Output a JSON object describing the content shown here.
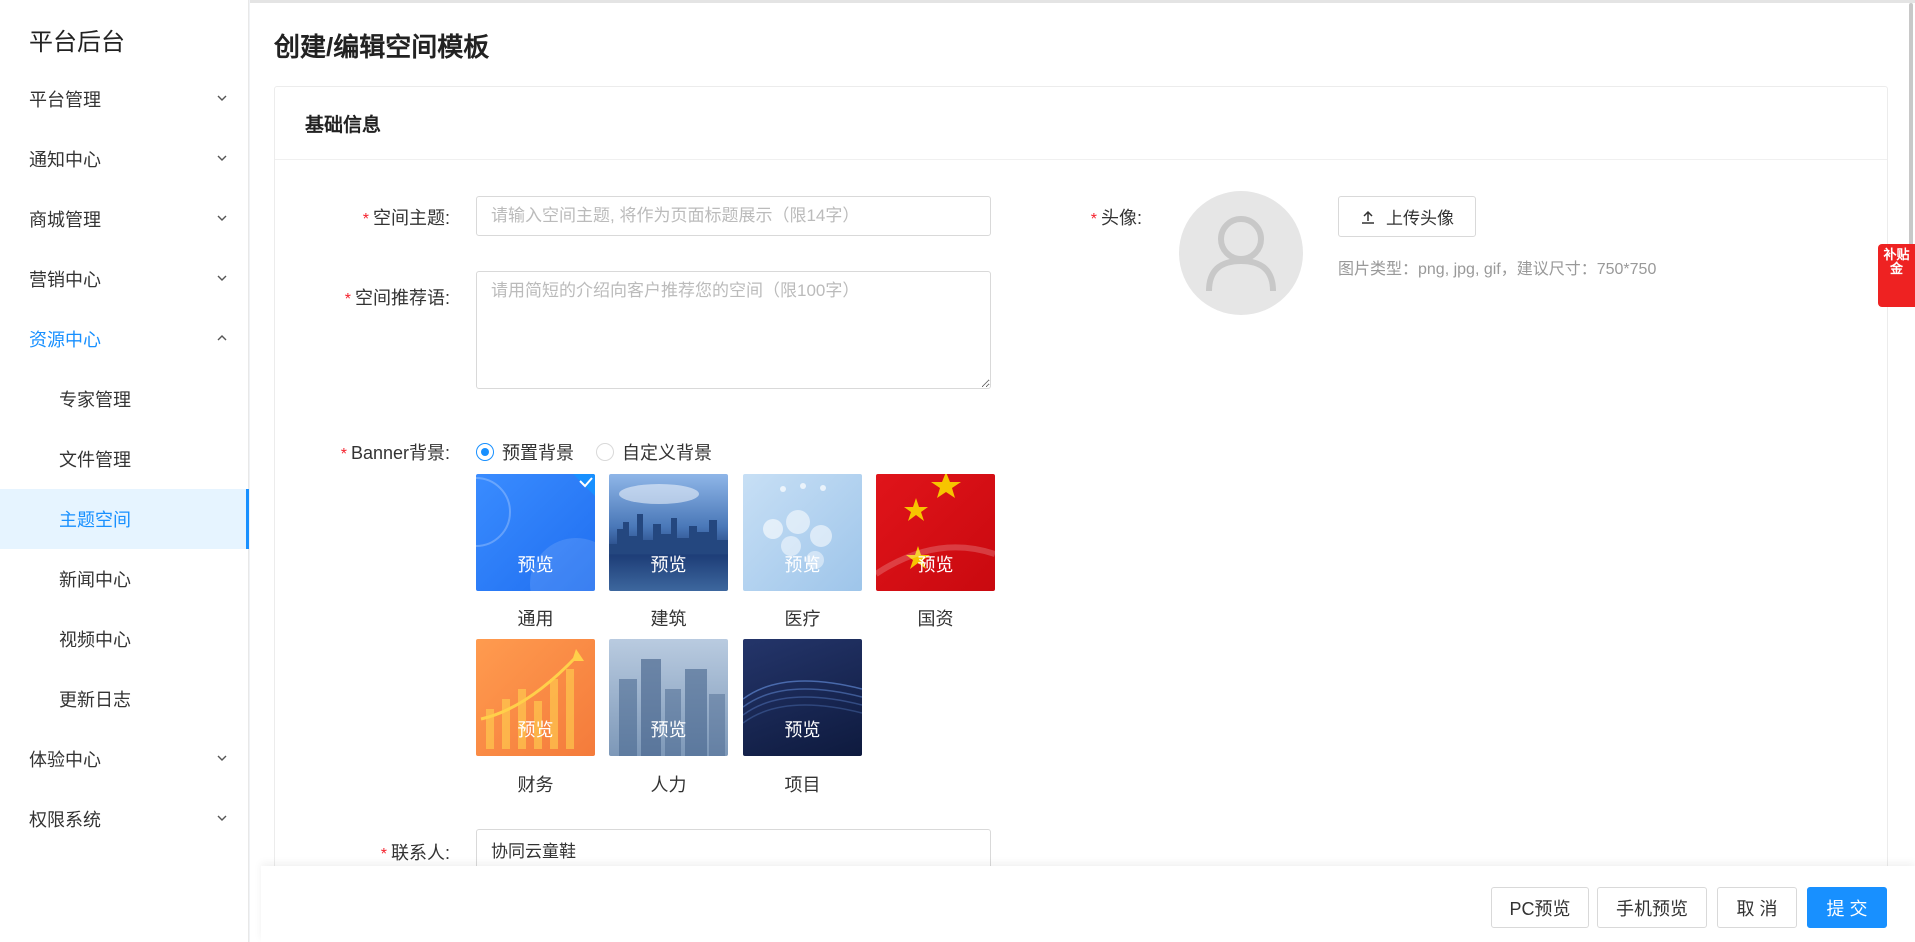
{
  "sidebar": {
    "brand": "平台后台",
    "items": [
      {
        "label": "平台管理",
        "chevron": "down"
      },
      {
        "label": "通知中心",
        "chevron": "down"
      },
      {
        "label": "商城管理",
        "chevron": "down"
      },
      {
        "label": "营销中心",
        "chevron": "down"
      },
      {
        "label": "资源中心",
        "chevron": "up"
      },
      {
        "label": "专家管理"
      },
      {
        "label": "文件管理"
      },
      {
        "label": "主题空间"
      },
      {
        "label": "新闻中心"
      },
      {
        "label": "视频中心"
      },
      {
        "label": "更新日志"
      },
      {
        "label": "体验中心",
        "chevron": "down"
      },
      {
        "label": "权限系统",
        "chevron": "down"
      }
    ]
  },
  "page": {
    "title": "创建/编辑空间模板",
    "section_title": "基础信息"
  },
  "form": {
    "topic_label": "空间主题:",
    "topic_placeholder": "请输入空间主题, 将作为页面标题展示（限14字）",
    "recommend_label": "空间推荐语:",
    "recommend_placeholder": "请用简短的介绍向客户推荐您的空间（限100字）",
    "avatar_label": "头像:",
    "upload_label": "上传头像",
    "upload_hint": "图片类型：png, jpg, gif，建议尺寸：750*750",
    "banner_label": "Banner背景:",
    "radio_preset": "预置背景",
    "radio_custom": "自定义背景",
    "preview_label": "预览",
    "banners": [
      {
        "name": "通用",
        "selected": true
      },
      {
        "name": "建筑",
        "selected": false
      },
      {
        "name": "医疗",
        "selected": false
      },
      {
        "name": "国资",
        "selected": false
      },
      {
        "name": "财务",
        "selected": false
      },
      {
        "name": "人力",
        "selected": false
      },
      {
        "name": "项目",
        "selected": false
      }
    ],
    "contact_label": "联系人:",
    "contact_value": "协同云童鞋"
  },
  "side_badge": "补贴金",
  "footer": {
    "pc_preview": "PC预览",
    "mobile_preview": "手机预览",
    "cancel": "取 消",
    "submit": "提 交"
  },
  "colors": {
    "primary": "#1890ff",
    "required": "#f5222d",
    "badge": "#e22222"
  }
}
